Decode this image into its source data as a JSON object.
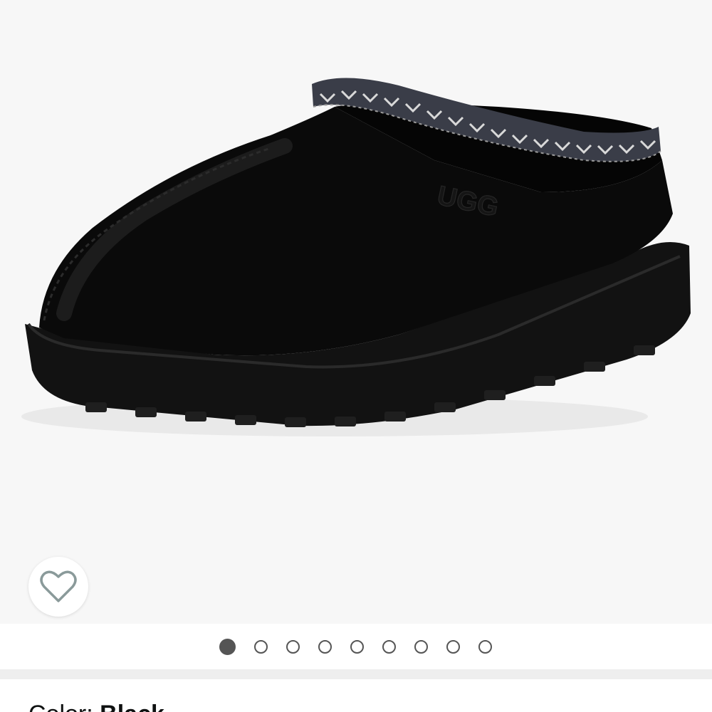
{
  "product": {
    "image_alt": "UGG black suede slipper",
    "brand_logo_text": "UGG",
    "color_label": "Color:",
    "color_value": "Black"
  },
  "wishlist": {
    "icon": "heart-outline-icon"
  },
  "carousel": {
    "count": 9,
    "active_index": 0
  },
  "colors": {
    "gallery_bg": "#f7f7f7",
    "dot_color": "#555555",
    "separator": "#eeeeee"
  }
}
